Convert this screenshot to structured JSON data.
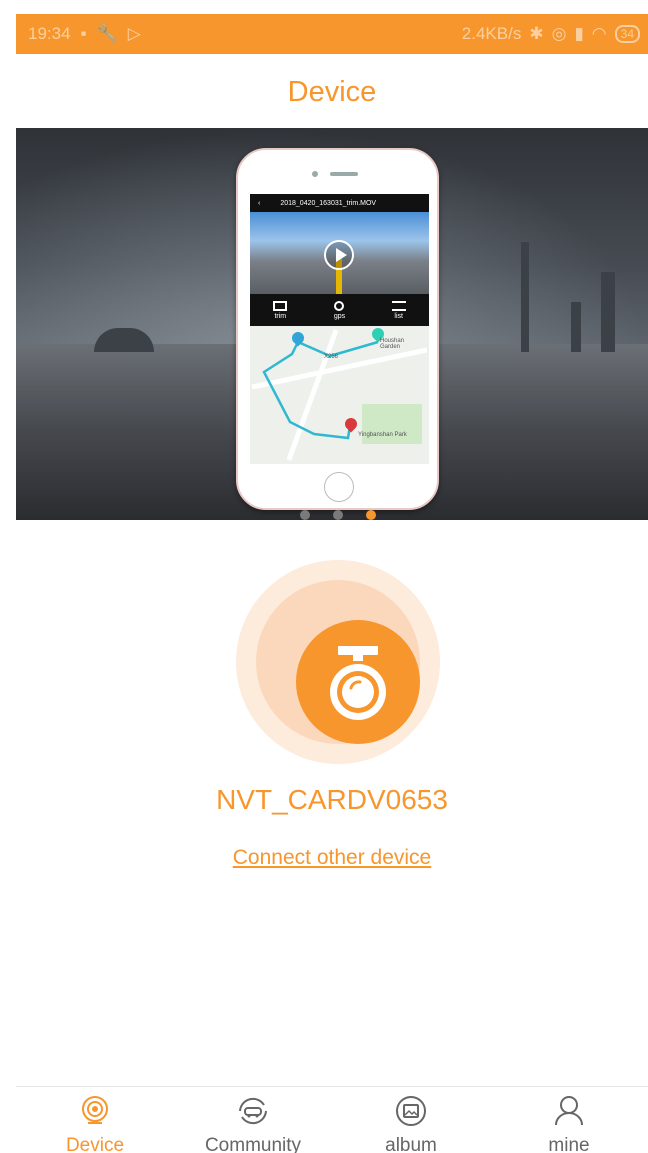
{
  "status_bar": {
    "time": "19:34",
    "speed": "2.4KB/s",
    "battery": "34"
  },
  "header": {
    "title": "Device"
  },
  "banner": {
    "video_filename": "2018_0420_163031_trim.MOV",
    "tools": [
      {
        "label": "trim"
      },
      {
        "label": "gps"
      },
      {
        "label": "list"
      }
    ],
    "map_labels": {
      "place1": "Houshan Garden",
      "place2": "Yingbanshan Park",
      "road": "X256"
    },
    "carousel": {
      "count": 3,
      "active_index": 2
    }
  },
  "device": {
    "name": "NVT_CARDV0653",
    "connect_other_label": "Connect other device"
  },
  "tabbar": {
    "tabs": [
      {
        "label": "Device",
        "icon": "camera-icon",
        "active": true
      },
      {
        "label": "Community",
        "icon": "community-icon",
        "active": false
      },
      {
        "label": "album",
        "icon": "album-icon",
        "active": false
      },
      {
        "label": "mine",
        "icon": "person-icon",
        "active": false
      }
    ]
  },
  "colors": {
    "accent": "#f7962c"
  }
}
